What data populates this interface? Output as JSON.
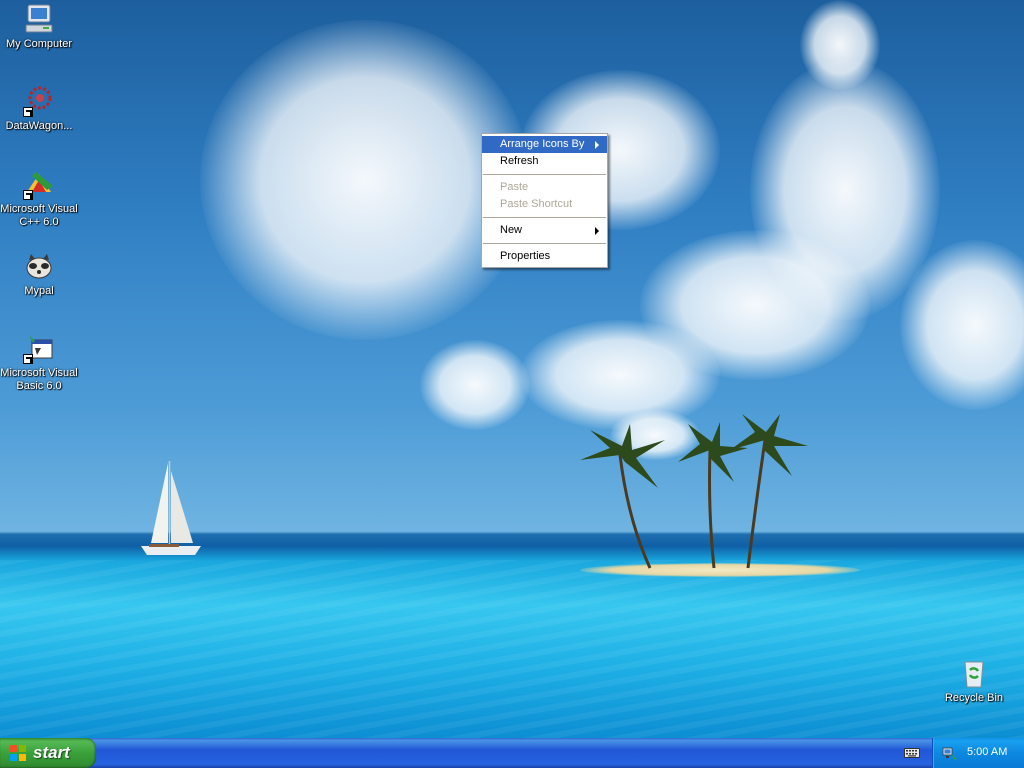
{
  "desktop": {
    "icons": [
      {
        "label": "My Computer",
        "icon": "computer-icon"
      },
      {
        "label": "DataWagon...",
        "icon": "datawagon-icon"
      },
      {
        "label": "Microsoft Visual C++ 6.0",
        "icon": "visual-cpp-icon"
      },
      {
        "label": "Mypal",
        "icon": "mypal-icon"
      },
      {
        "label": "Microsoft Visual Basic 6.0",
        "icon": "visual-basic-icon"
      },
      {
        "label": "Recycle Bin",
        "icon": "recycle-bin-icon"
      }
    ]
  },
  "context_menu": {
    "items": [
      {
        "label": "Arrange Icons By",
        "submenu": true,
        "selected": true,
        "enabled": true
      },
      {
        "label": "Refresh",
        "enabled": true
      },
      {
        "label": "Paste",
        "enabled": false
      },
      {
        "label": "Paste Shortcut",
        "enabled": false
      },
      {
        "label": "New",
        "submenu": true,
        "enabled": true
      },
      {
        "label": "Properties",
        "enabled": true
      }
    ]
  },
  "taskbar": {
    "start_label": "start",
    "clock": "5:00 AM",
    "tray_icons": [
      "keyboard-icon",
      "network-icon"
    ]
  },
  "colors": {
    "menu_highlight": "#316ac5",
    "taskbar_blue": "#245edb",
    "start_green": "#3aa13a",
    "tray_blue": "#0c88e0",
    "disabled_text": "#aca899"
  }
}
